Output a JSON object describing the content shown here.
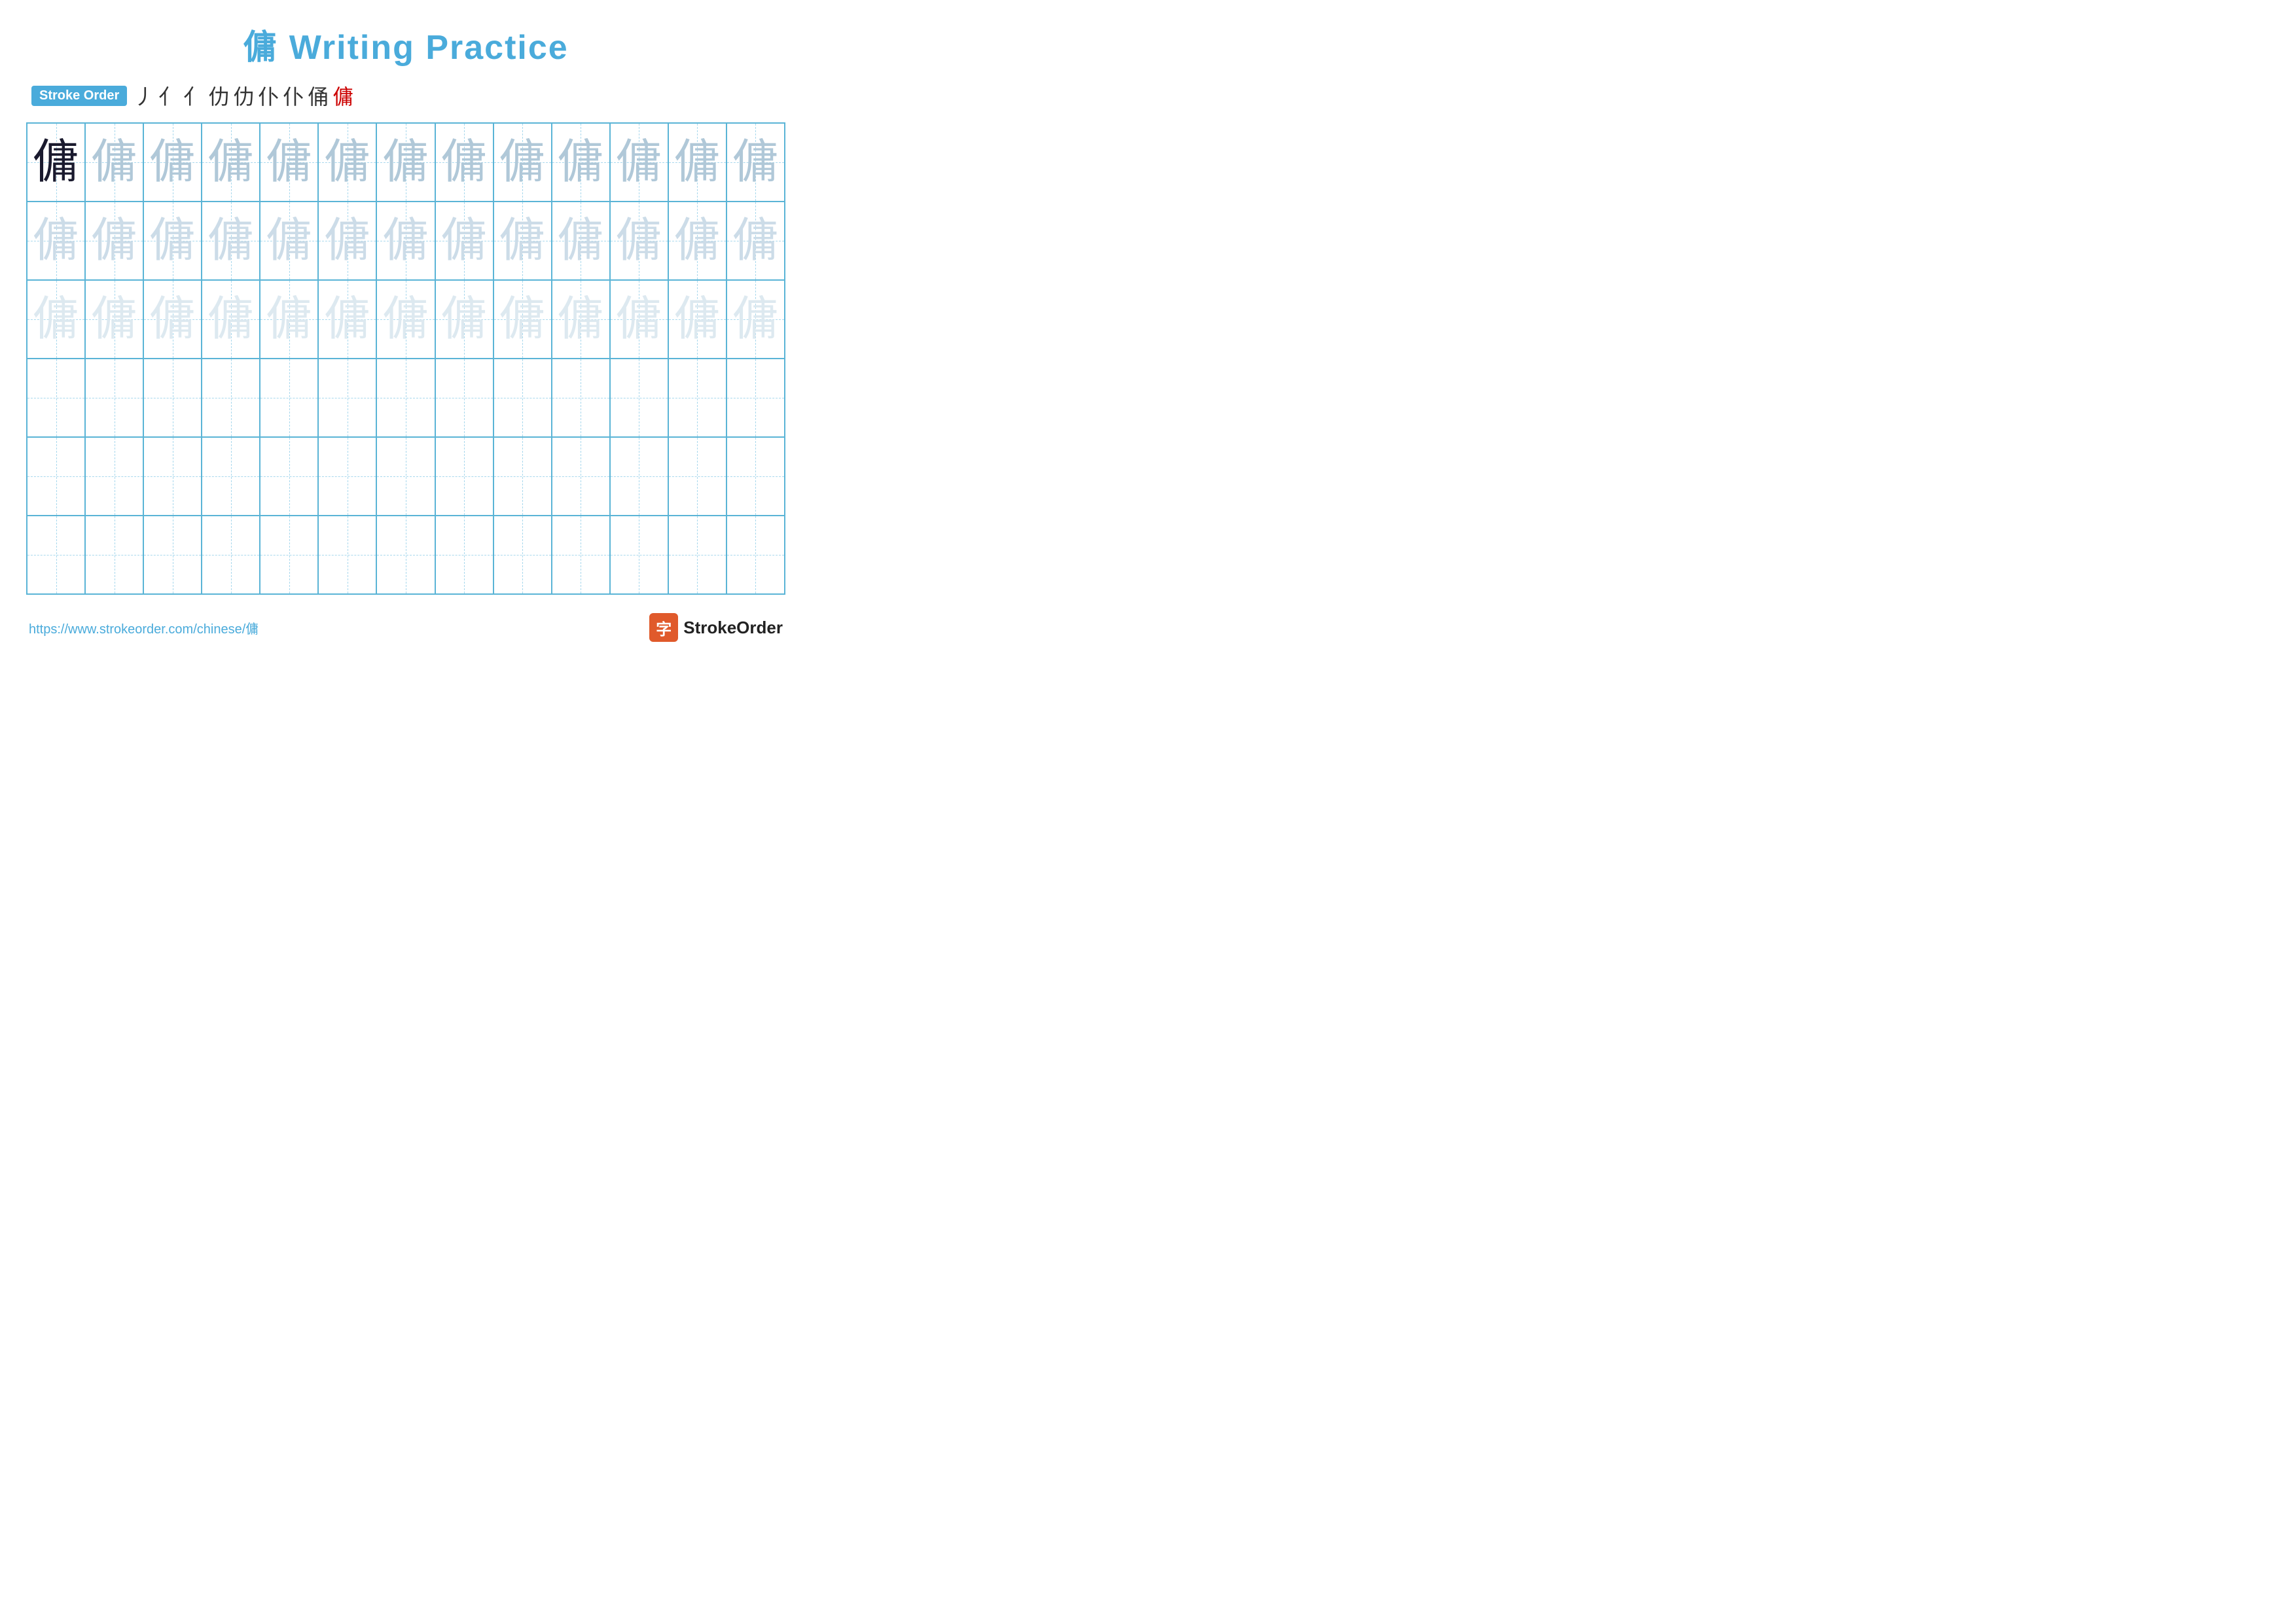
{
  "title": {
    "text": "傭 Writing Practice"
  },
  "stroke_order": {
    "badge_label": "Stroke Order",
    "strokes": [
      "丿",
      "亻",
      "亻",
      "仂",
      "仂",
      "仆",
      "仆",
      "俑",
      "傭"
    ]
  },
  "grid": {
    "cols": 13,
    "rows": 6,
    "character": "傭",
    "row_styles": [
      "dark",
      "medium",
      "light",
      "very-light",
      "very-light",
      "very-light"
    ]
  },
  "footer": {
    "url": "https://www.strokeorder.com/chinese/傭",
    "logo_char": "字",
    "logo_text": "StrokeOrder"
  }
}
